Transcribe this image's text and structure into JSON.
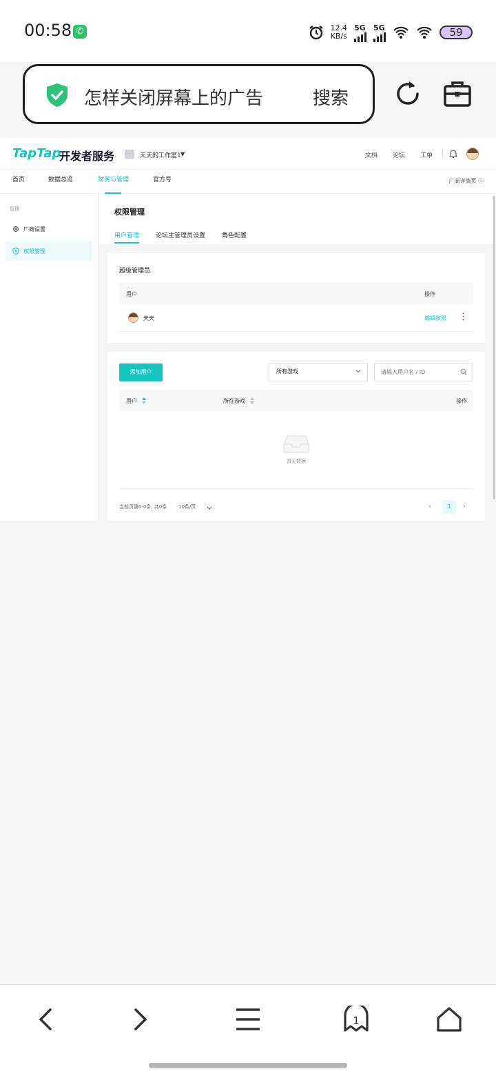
{
  "status_bar": {
    "time": "00:58",
    "net_speed_value": "12.4",
    "net_speed_unit": "KB/s",
    "sim1": "5G",
    "sim2": "5G",
    "battery": "59"
  },
  "browser": {
    "search_query": "怎样关闭屏幕上的广告",
    "search_button": "搜索"
  },
  "site": {
    "logo": "TapTap",
    "logo_sub": "开发者服务",
    "workspace": "天天的工作室1",
    "top_links": [
      "文档",
      "论坛",
      "工单"
    ],
    "nav_tabs": [
      "首页",
      "数据总览",
      "财务与管理",
      "官方号"
    ],
    "active_nav": "财务与管理",
    "vendor_detail": "厂商详情页"
  },
  "sidebar": {
    "group": "管理",
    "items": [
      {
        "label": "厂商设置",
        "icon": "gear-icon",
        "active": false
      },
      {
        "label": "权限管理",
        "icon": "shield-icon",
        "active": true
      }
    ]
  },
  "content": {
    "title": "权限管理",
    "tabs": [
      "用户管理",
      "论坛主管理员设置",
      "角色配置"
    ],
    "active_tab": "用户管理",
    "super_admin": {
      "title": "超级管理员",
      "columns": [
        "用户",
        "操作"
      ],
      "rows": [
        {
          "user": "天天",
          "action": "编辑权限"
        }
      ]
    },
    "users": {
      "add_button": "添加用户",
      "game_select": "所有游戏",
      "search_placeholder": "请输入用户名 / ID",
      "columns": [
        "用户",
        "所在游戏",
        "操作"
      ],
      "empty_text": "暂无数据",
      "pagination_info": "当前页第0-0条, 共0条",
      "page_size": "10条/页",
      "current_page": "1"
    }
  },
  "colors": {
    "accent": "#15c5c0"
  }
}
